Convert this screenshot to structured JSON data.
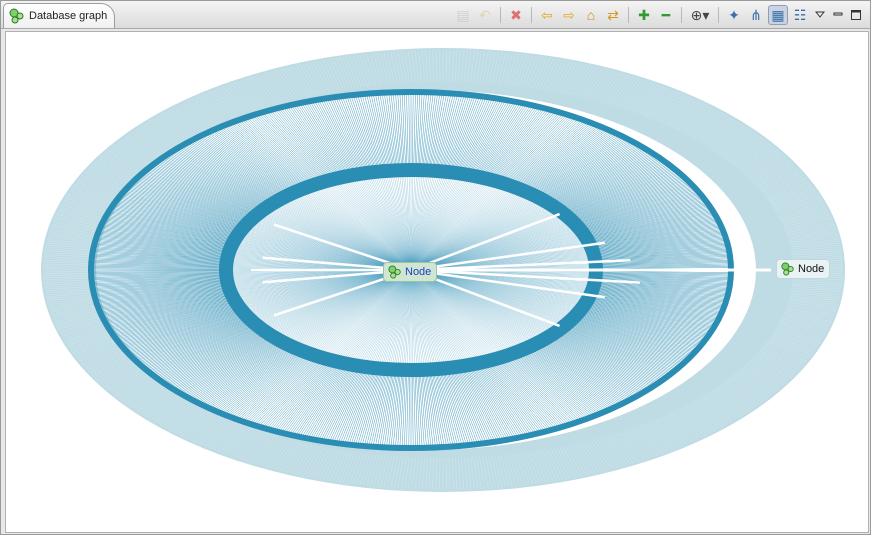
{
  "window": {
    "tab_title": "Database graph",
    "tab_icon": "graph-node-icon"
  },
  "toolbar": {
    "buttons": [
      {
        "icon": "save-icon",
        "glyph": "▤",
        "color": "#b8c2cc",
        "enabled": false
      },
      {
        "icon": "undo-icon",
        "glyph": "↶",
        "color": "#d8c890",
        "enabled": false
      },
      {
        "icon": "delete-icon",
        "glyph": "✖",
        "color": "#e07070",
        "enabled": true
      },
      {
        "icon": "back-arrow-icon",
        "glyph": "⇦",
        "color": "#e8a420",
        "enabled": true
      },
      {
        "icon": "forward-arrow-icon",
        "glyph": "⇨",
        "color": "#e8a420",
        "enabled": true
      },
      {
        "icon": "home-icon",
        "glyph": "⌂",
        "color": "#c98a22",
        "enabled": true
      },
      {
        "icon": "refresh-icon",
        "glyph": "⇄",
        "color": "#d49a20",
        "enabled": true
      },
      {
        "icon": "add-icon",
        "glyph": "✚",
        "color": "#2f9a2f",
        "enabled": true
      },
      {
        "icon": "remove-icon",
        "glyph": "━",
        "color": "#2f9a2f",
        "enabled": true
      },
      {
        "icon": "zoom-icon",
        "glyph": "⊕▾",
        "color": "#444444",
        "enabled": true
      },
      {
        "icon": "layout-force-icon",
        "glyph": "✦",
        "color": "#3a6ea8",
        "enabled": true
      },
      {
        "icon": "layout-tree-icon",
        "glyph": "⋔",
        "color": "#3a6ea8",
        "enabled": true
      },
      {
        "icon": "layout-radial-icon",
        "glyph": "▦",
        "color": "#3a6ea8",
        "enabled": true,
        "pressed": true
      },
      {
        "icon": "layout-grid-icon",
        "glyph": "☷",
        "color": "#3a6ea8",
        "enabled": true
      }
    ],
    "view_menu_icon": "view-menu-chevron-icon",
    "minimize_icon": "minimize-icon",
    "maximize_icon": "maximize-icon"
  },
  "graph": {
    "center_node": {
      "label": "Node"
    },
    "selected_node": {
      "label": "Node"
    },
    "edge_color": "#2a8db3",
    "shadow_color": "#a9cfda",
    "highlight_color": "#ffffff"
  }
}
